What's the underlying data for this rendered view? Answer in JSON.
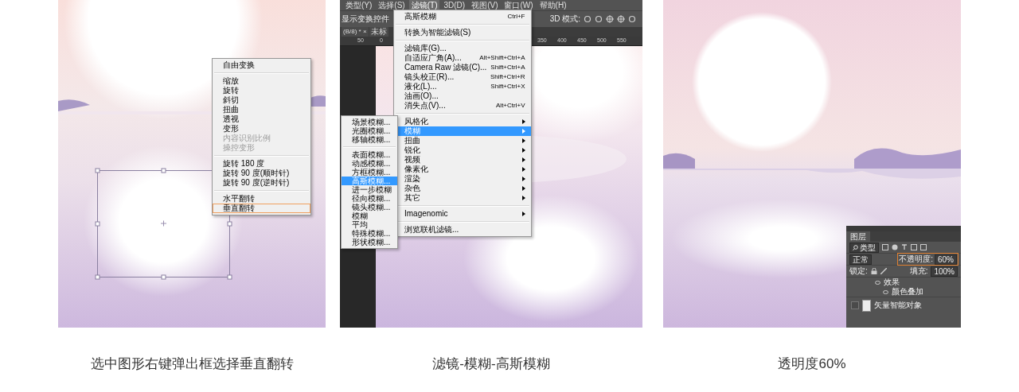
{
  "panels": [
    {
      "kind": "context-menu",
      "background": {
        "kind": "picture"
      },
      "menu": {
        "groups": [
          [
            {
              "label": "自由变换",
              "disabled": false,
              "selected": false
            }
          ],
          [
            {
              "label": "缩放",
              "disabled": false,
              "selected": false
            },
            {
              "label": "旋转",
              "disabled": false,
              "selected": false
            },
            {
              "label": "斜切",
              "disabled": false,
              "selected": false
            },
            {
              "label": "扭曲",
              "disabled": false,
              "selected": false
            },
            {
              "label": "透视",
              "disabled": false,
              "selected": false
            },
            {
              "label": "变形",
              "disabled": false,
              "selected": false
            },
            {
              "label": "内容识别比例",
              "disabled": true,
              "selected": false
            },
            {
              "label": "操控变形",
              "disabled": true,
              "selected": false
            }
          ],
          [
            {
              "label": "旋转 180 度",
              "disabled": false,
              "selected": false
            },
            {
              "label": "旋转 90 度(顺时针)",
              "disabled": false,
              "selected": false
            },
            {
              "label": "旋转 90 度(逆时针)",
              "disabled": false,
              "selected": false
            }
          ],
          [
            {
              "label": "水平翻转",
              "disabled": false,
              "selected": false
            },
            {
              "label": "垂直翻转",
              "disabled": false,
              "selected": true
            }
          ]
        ]
      },
      "caption": "选中图形右键弹出框选择垂直翻转"
    },
    {
      "kind": "filter-menu",
      "background": {
        "kind": "picture"
      },
      "menubar": [
        {
          "label": "类型(Y)",
          "selected": false
        },
        {
          "label": "选择(S)",
          "selected": false
        },
        {
          "label": "滤镜(T)",
          "selected": true
        },
        {
          "label": "3D(D)",
          "selected": false
        },
        {
          "label": "视图(V)",
          "selected": false
        },
        {
          "label": "窗口(W)",
          "selected": false
        },
        {
          "label": "帮助(H)",
          "selected": false
        }
      ],
      "toolbar": {
        "label": "显示变换控件",
        "mode_label": "3D 模式:"
      },
      "tabs": [
        {
          "label": "(B/8) * ×"
        },
        {
          "label": "未标"
        }
      ],
      "ruler": [
        "50",
        "0",
        "350",
        "400",
        "450",
        "500",
        "550"
      ],
      "menu": {
        "groups": [
          [
            {
              "label": "高斯模糊",
              "shortcut": "Ctrl+F",
              "has_submenu": false,
              "selected": false
            }
          ],
          [
            {
              "label": "转换为智能滤镜(S)",
              "has_submenu": false,
              "selected": false
            }
          ],
          [
            {
              "label": "滤镜库(G)...",
              "has_submenu": false,
              "selected": false
            },
            {
              "label": "自适应广角(A)...",
              "shortcut": "Alt+Shift+Ctrl+A",
              "has_submenu": false,
              "selected": false
            },
            {
              "label": "Camera Raw 滤镜(C)...",
              "shortcut": "Shift+Ctrl+A",
              "has_submenu": false,
              "selected": false
            },
            {
              "label": "镜头校正(R)...",
              "shortcut": "Shift+Ctrl+R",
              "has_submenu": false,
              "selected": false
            },
            {
              "label": "液化(L)...",
              "shortcut": "Shift+Ctrl+X",
              "has_submenu": false,
              "selected": false
            },
            {
              "label": "油画(O)...",
              "has_submenu": false,
              "selected": false
            },
            {
              "label": "消失点(V)...",
              "shortcut": "Alt+Ctrl+V",
              "has_submenu": false,
              "selected": false
            }
          ],
          [
            {
              "label": "风格化",
              "has_submenu": true,
              "selected": false
            },
            {
              "label": "模糊",
              "has_submenu": true,
              "selected": true
            },
            {
              "label": "扭曲",
              "has_submenu": true,
              "selected": false
            },
            {
              "label": "锐化",
              "has_submenu": true,
              "selected": false
            },
            {
              "label": "视频",
              "has_submenu": true,
              "selected": false
            },
            {
              "label": "像素化",
              "has_submenu": true,
              "selected": false
            },
            {
              "label": "渲染",
              "has_submenu": true,
              "selected": false
            },
            {
              "label": "杂色",
              "has_submenu": true,
              "selected": false
            },
            {
              "label": "其它",
              "has_submenu": true,
              "selected": false
            }
          ],
          [
            {
              "label": "Imagenomic",
              "has_submenu": true,
              "selected": false
            }
          ],
          [
            {
              "label": "浏览联机滤镜...",
              "has_submenu": false,
              "selected": false
            }
          ]
        ]
      },
      "submenu": {
        "groups": [
          [
            {
              "label": "场景模糊...",
              "selected": false
            },
            {
              "label": "光圈模糊...",
              "selected": false
            },
            {
              "label": "移轴模糊...",
              "selected": false
            }
          ],
          [
            {
              "label": "表面模糊...",
              "selected": false
            },
            {
              "label": "动感模糊...",
              "selected": false
            },
            {
              "label": "方框模糊...",
              "selected": false
            },
            {
              "label": "高斯模糊...",
              "selected": true
            },
            {
              "label": "进一步模糊",
              "selected": false
            },
            {
              "label": "径向模糊...",
              "selected": false
            },
            {
              "label": "镜头模糊...",
              "selected": false
            },
            {
              "label": "模糊",
              "selected": false
            },
            {
              "label": "平均",
              "selected": false
            },
            {
              "label": "特殊模糊...",
              "selected": false
            },
            {
              "label": "形状模糊...",
              "selected": false
            }
          ]
        ]
      },
      "caption": "滤镜-模糊-高斯模糊"
    },
    {
      "kind": "layers-panel",
      "background": {
        "kind": "picture"
      },
      "layers_panel": {
        "tab": "图层",
        "filter": "类型",
        "blend_mode": "正常",
        "opacity": {
          "label": "不透明度:",
          "value": "60%",
          "highlighted": true
        },
        "lock_label": "锁定:",
        "fill": {
          "label": "填充:",
          "value": "100%"
        },
        "layers": [
          {
            "label": "效果",
            "kind": "effects"
          },
          {
            "label": "颜色叠加",
            "kind": "effect"
          },
          {
            "label": "矢量智能对象",
            "kind": "layer"
          }
        ]
      },
      "caption": "透明度60%"
    }
  ]
}
